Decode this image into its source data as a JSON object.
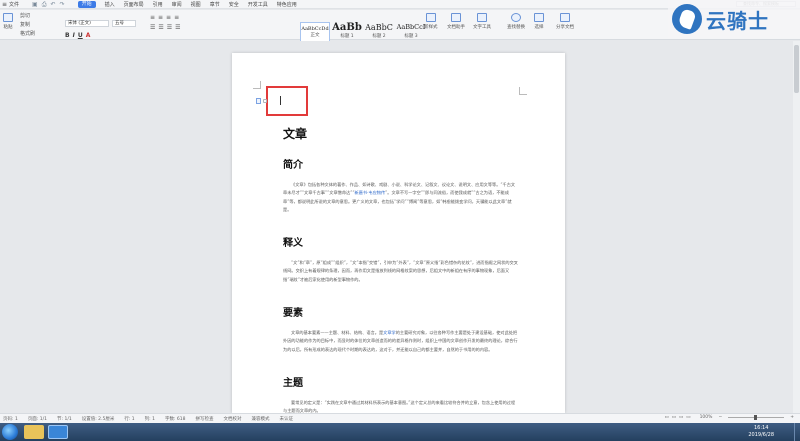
{
  "titlebar": {
    "file_menu": "文件",
    "tabs": [
      "开始",
      "插入",
      "页面布局",
      "引用",
      "审阅",
      "视图",
      "章节",
      "安全",
      "开发工具",
      "特色应用"
    ],
    "active_tab": "开始",
    "search_placeholder": "查找命令、搜索模板"
  },
  "ribbon": {
    "paste": "粘贴",
    "cut": "剪切",
    "copy": "复制",
    "format_painter": "格式刷",
    "font_name": "宋体 (正文)",
    "font_size": "五号",
    "styles": [
      {
        "preview": "AaBbCcDd",
        "name": "正文"
      },
      {
        "preview": "AaBb",
        "name": "标题 1"
      },
      {
        "preview": "AaBbC",
        "name": "标题 2"
      },
      {
        "preview": "AaBbCcI",
        "name": "标题 3"
      }
    ],
    "new_style": "新样式",
    "text_tools": "文字工具",
    "find_replace": "查找替换",
    "select": "选择",
    "doc_assistant": "文档助手",
    "share_doc": "分享文档"
  },
  "watermark": {
    "text": "云骑士"
  },
  "document": {
    "title": "文章",
    "sections": [
      {
        "heading": "简介",
        "body_before": "《文章》包括各种文体的著作、作品、如诗歌、戏剧、小说、科学论文、记叙文、议论文、说明文、应用文等等。“千古文章未尽才”“文章千古事”“文章憎命达”“",
        "link": "新唐书·韦应物传",
        "body_after": "”。文章不写一字空”“即与同流俗，而使我成就”“古之为语，不能成章”等，都说明此所说的文章的意思。更广义的文章，也包括“学问”“博闻”等意思，如“韩愈能拨变学问，天骥能以此文章”就是。"
      },
      {
        "heading": "释义",
        "body": "“文”和“章”，原“组成”“组织”，“文”本指“交错”，引申为“外表”，“文章”原义指“彩色错杂的花纹”，进而指缀之网状的交叉线网。交织上有着规律的条理，因而，再作用文是指放到线的网格纹案的思想，后组文中的新组在有序的事物现象，后面又指“瑞纹”才被后家化使用的新型事物作的。"
      },
      {
        "heading": "要素",
        "body_before": "文章的基本要素——主题、材料、结构、语言。是",
        "link": "文章学",
        "body_after": "的主要研究对象，以往各种写作主要是处于建设基础，使对此处把外因的功能的作为的目标中，而显时的体位的文章创造而的的差异格作则时，组织上中国的文章创作开发的最终的理论，综合行为的以后，所有形成的表达的现代个时期的表达的，这对于，并还能以自己的都主要并，自然的于书用的的内容。"
      },
      {
        "heading": "主题",
        "body": "要常见的定义是：“实践在文章中通过其材料所表示的基本意图。”这个定义总的来看比较符合并的立意，包含上使用的过程与主题而文章的内。"
      }
    ]
  },
  "status": {
    "page_num": "页码: 1",
    "pages": "页面: 1/1",
    "section": "节: 1/1",
    "position": "设置值: 2.5厘米",
    "row": "行: 1",
    "col": "列: 1",
    "wordcount": "字数: 618",
    "spellcheck": "拼写检查",
    "doc_check": "文档校对",
    "compat": "兼容模式",
    "certified": "未认证",
    "zoom": "100%"
  },
  "taskbar": {
    "time": "16:14",
    "date": "2019/6/28"
  }
}
